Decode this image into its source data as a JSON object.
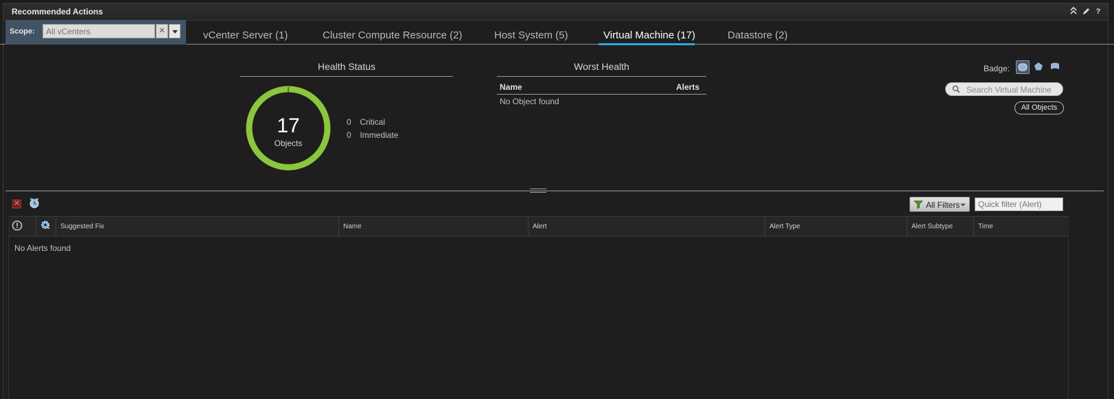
{
  "header": {
    "title": "Recommended Actions",
    "icons": [
      "collapse-icon",
      "edit-icon",
      "help-icon"
    ]
  },
  "scope": {
    "label": "Scope:",
    "placeholder": "All vCenters"
  },
  "tabs": [
    {
      "label": "vCenter Server (1)",
      "active": false
    },
    {
      "label": "Cluster Compute Resource (2)",
      "active": false
    },
    {
      "label": "Host System (5)",
      "active": false
    },
    {
      "label": "Virtual Machine (17)",
      "active": true
    },
    {
      "label": "Datastore (2)",
      "active": false
    }
  ],
  "health": {
    "title": "Health Status",
    "count": "17",
    "count_label": "Objects",
    "legend": [
      {
        "value": "0",
        "label": "Critical"
      },
      {
        "value": "0",
        "label": "Immediate"
      }
    ],
    "ring_color": "#8cc63f"
  },
  "worst": {
    "title": "Worst Health",
    "col_name": "Name",
    "col_alerts": "Alerts",
    "empty": "No Object found"
  },
  "badge": {
    "label": "Badge:",
    "options": [
      "health-badge-icon",
      "risk-badge-icon",
      "efficiency-badge-icon"
    ]
  },
  "search": {
    "placeholder": "Search Virtual Machine"
  },
  "all_objects": "All Objects",
  "alerts_toolbar": {
    "filters_label": "All Filters",
    "quick_filter_placeholder": "Quick filter (Alert)"
  },
  "grid": {
    "columns": [
      "Suggested Fix",
      "Name",
      "Alert",
      "Alert Type",
      "Alert Subtype",
      "Time"
    ],
    "empty": "No Alerts found"
  },
  "colors": {
    "accent": "#2aa7e6",
    "scope_bg": "#425364",
    "health_ring": "#8cc63f"
  }
}
